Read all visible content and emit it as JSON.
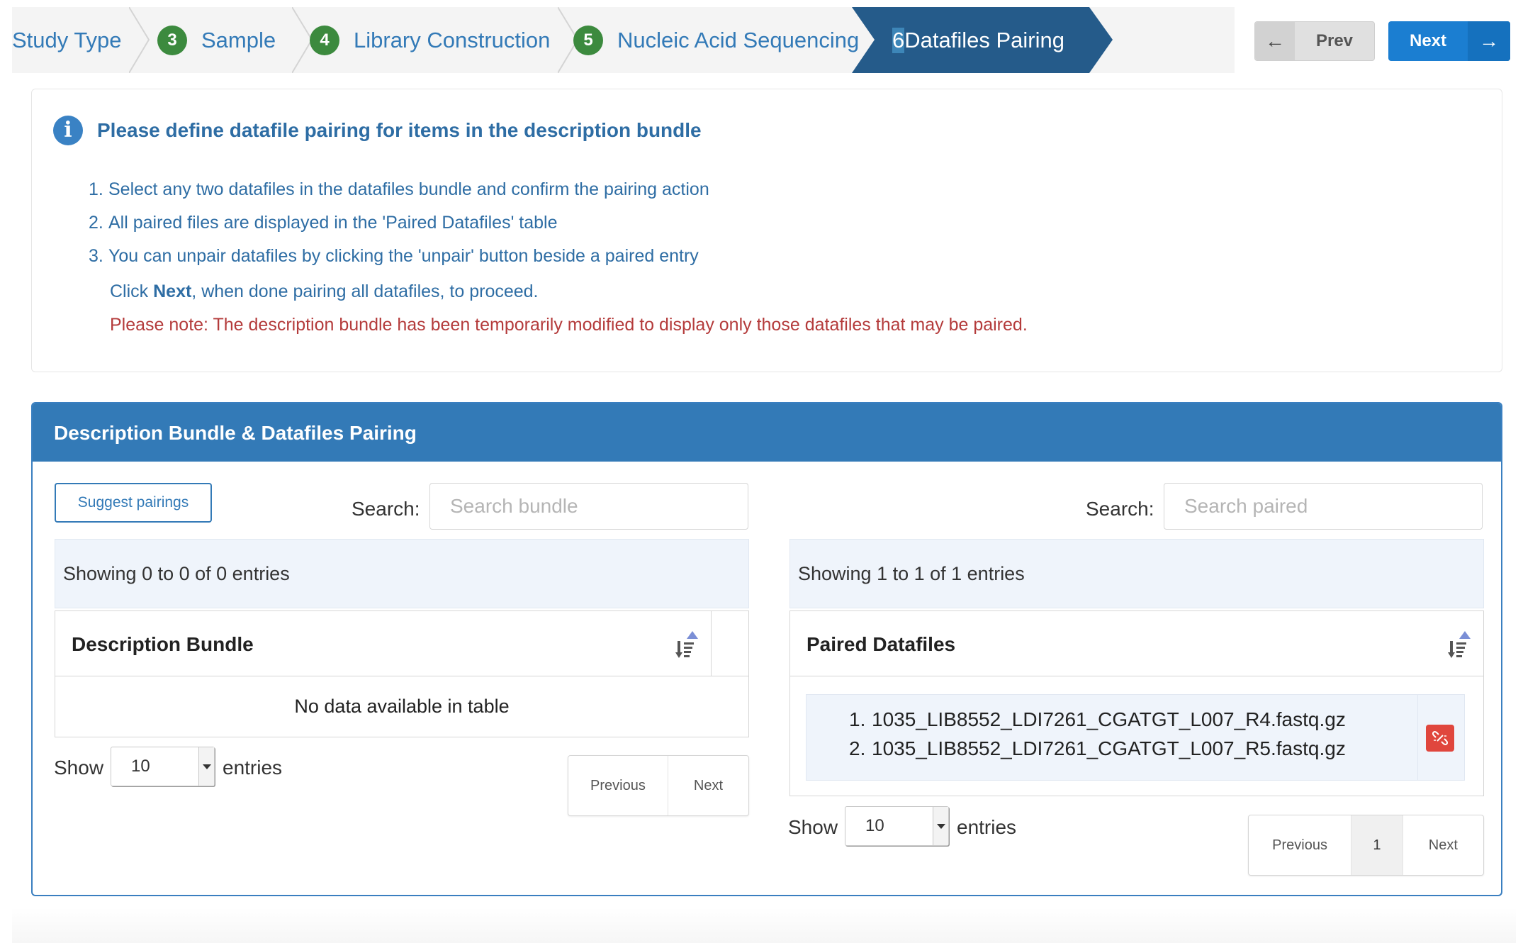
{
  "wizard": {
    "steps": [
      {
        "num": "",
        "label": "Study Type"
      },
      {
        "num": "3",
        "label": "Sample"
      },
      {
        "num": "4",
        "label": "Library Construction"
      },
      {
        "num": "5",
        "label": "Nucleic Acid Sequencing"
      }
    ],
    "active": {
      "num": "6",
      "label": "Datafiles Pairing"
    },
    "prev_label": "Prev",
    "next_label": "Next",
    "prev_icon": "arrow-left-icon",
    "next_icon": "arrow-right-icon"
  },
  "info": {
    "title": "Please define datafile pairing for items in the description bundle",
    "items": [
      {
        "num": "1.",
        "text": "Select any two datafiles in the datafiles bundle and confirm the pairing action"
      },
      {
        "num": "2.",
        "text": "All paired files are displayed in the 'Paired Datafiles' table"
      },
      {
        "num": "3.",
        "text": "You can unpair datafiles by clicking the 'unpair' button beside a paired entry"
      }
    ],
    "click_prefix": "Click ",
    "click_bold": "Next",
    "click_suffix": ", when done pairing all datafiles, to proceed.",
    "note": "Please note: The description bundle has been temporarily modified to display only those datafiles that may be paired."
  },
  "pairing": {
    "title": "Description Bundle & Datafiles Pairing",
    "suggest_label": "Suggest pairings",
    "left": {
      "search_label": "Search:",
      "search_placeholder": "Search bundle",
      "search_value": "",
      "showing": "Showing 0 to 0 of 0 entries",
      "column": "Description Bundle",
      "empty": "No data available in table",
      "show_label": "Show",
      "page_size": "10",
      "entries_label": "entries",
      "pager": {
        "previous": "Previous",
        "next": "Next"
      }
    },
    "right": {
      "search_label": "Search:",
      "search_placeholder": "Search paired",
      "search_value": "",
      "showing": "Showing 1 to 1 of 1 entries",
      "column": "Paired Datafiles",
      "pairs": [
        {
          "num": "1.",
          "file": "1035_LIB8552_LDI7261_CGATGT_L007_R4.fastq.gz"
        },
        {
          "num": "2.",
          "file": "1035_LIB8552_LDI7261_CGATGT_L007_R5.fastq.gz"
        }
      ],
      "unpair_icon": "unlink-icon",
      "show_label": "Show",
      "page_size": "10",
      "entries_label": "entries",
      "pager": {
        "previous": "Previous",
        "page": "1",
        "next": "Next"
      }
    }
  },
  "colors": {
    "accent": "#337ab7",
    "step_badge": "#3c8a3e",
    "active_step": "#255b8a",
    "next_button": "#1b7ed1",
    "note_text": "#b43b3b",
    "unpair_button": "#e0463d"
  }
}
